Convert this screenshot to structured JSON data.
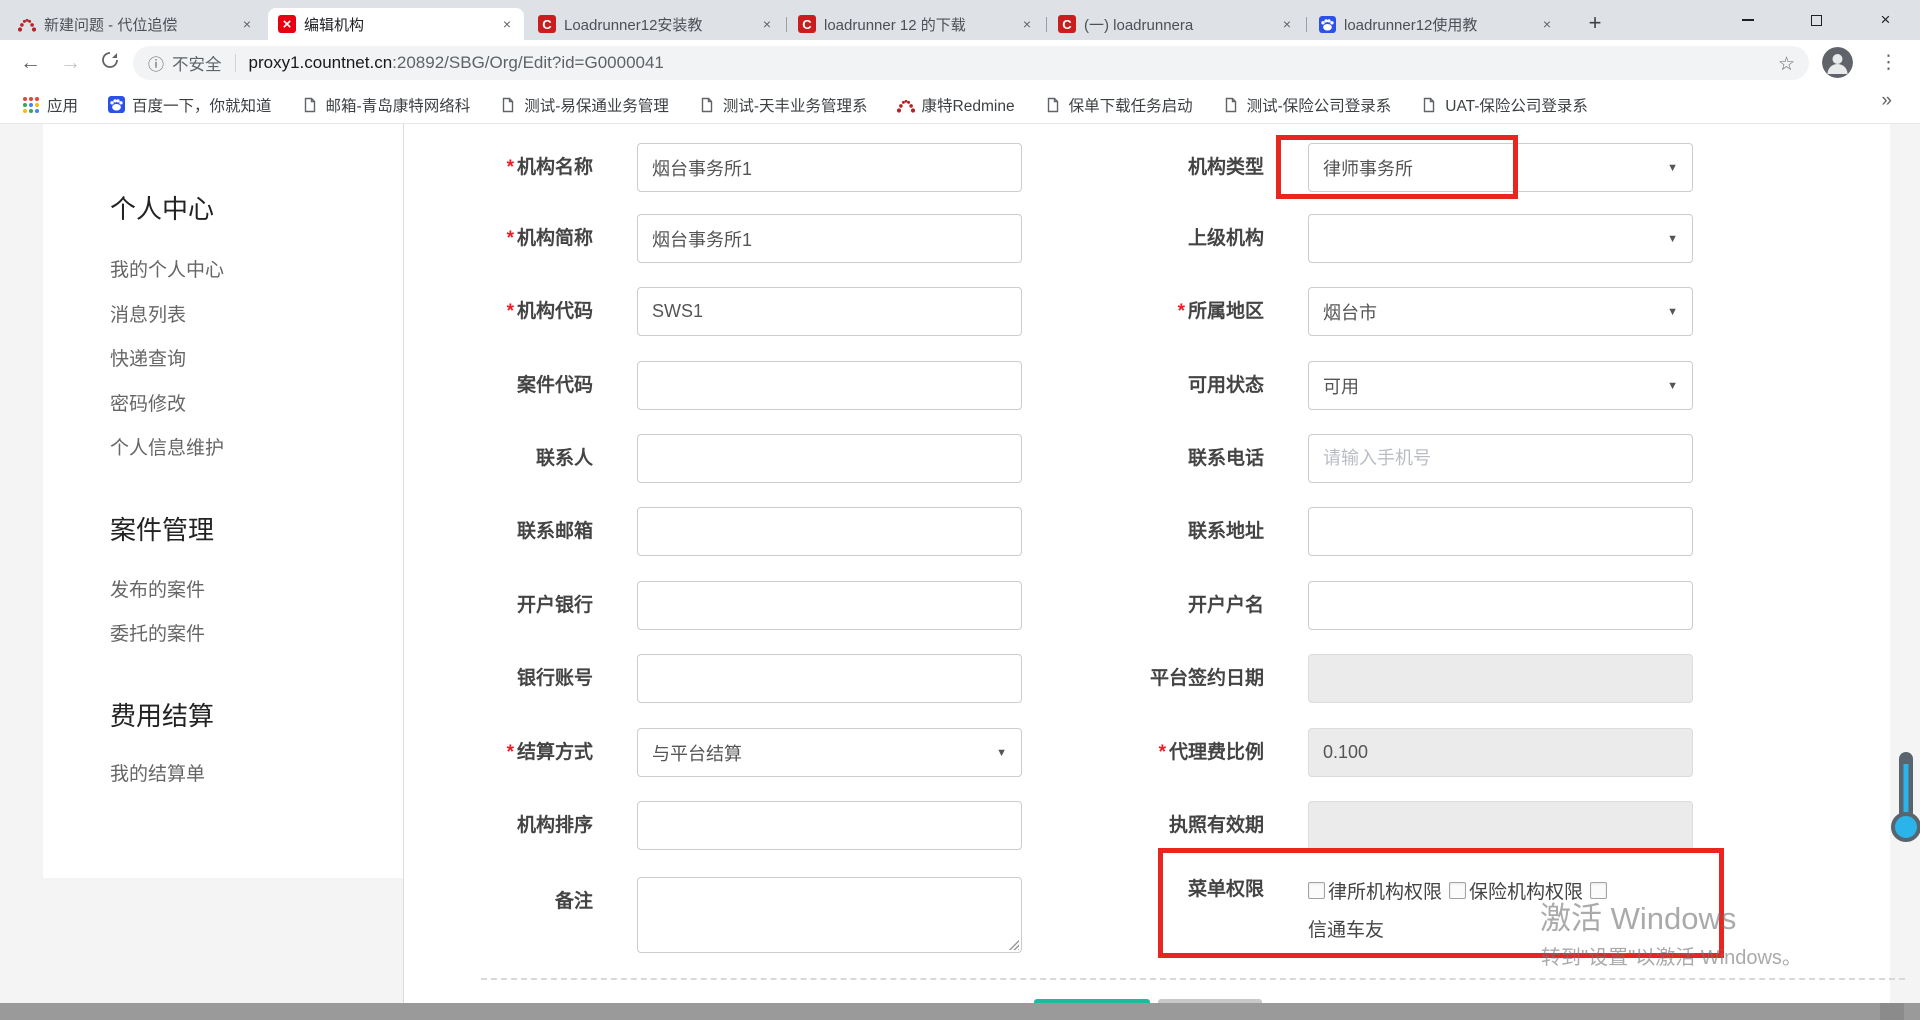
{
  "colors": {
    "chrome_bg": "#dee1e6",
    "highlight_red": "#e8251f",
    "save_teal": "#1abc9c",
    "scrollbar_grey": "#9a9a9a",
    "csdn_red": "#ca1e1e",
    "baidu_blue": "#2b51e8",
    "redmine_red": "#b3252a",
    "kangte_red": "#e60012"
  },
  "icons": {
    "close": "×",
    "plus": "+",
    "back": "←",
    "forward": "→",
    "info": "ⓘ",
    "star": "☆",
    "dots": "⋮",
    "overflow": "»",
    "dropdown": "▼"
  },
  "tabs": [
    {
      "title": "新建问题 - 代位追偿",
      "icon": "redmine",
      "active": false
    },
    {
      "title": "编辑机构",
      "icon": "kangte-x",
      "active": true
    },
    {
      "title": "Loadrunner12安装教",
      "icon": "csdn",
      "active": false
    },
    {
      "title": "loadrunner 12 的下载",
      "icon": "csdn",
      "active": false
    },
    {
      "title": "(一) loadrunnera",
      "icon": "csdn",
      "active": false
    },
    {
      "title": "loadrunner12使用教",
      "icon": "baidu",
      "active": false
    }
  ],
  "address": {
    "security_label": "不安全",
    "url_host": "proxy1.countnet.cn",
    "url_rest": ":20892/SBG/Org/Edit?id=G0000041"
  },
  "bookmarks": [
    {
      "label": "应用",
      "icon": "apps-grid"
    },
    {
      "label": "百度一下，你就知道",
      "icon": "baidu"
    },
    {
      "label": "邮箱-青岛康特网络科",
      "icon": "page"
    },
    {
      "label": "测试-易保通业务管理",
      "icon": "page"
    },
    {
      "label": "测试-天丰业务管理系",
      "icon": "page"
    },
    {
      "label": "康特Redmine",
      "icon": "redmine"
    },
    {
      "label": "保单下载任务启动",
      "icon": "page"
    },
    {
      "label": "测试-保险公司登录系",
      "icon": "page"
    },
    {
      "label": "UAT-保险公司登录系",
      "icon": "page"
    }
  ],
  "bookmarks_overflow": "»",
  "sidebar": {
    "sections": [
      {
        "title": "个人中心",
        "items": [
          "我的个人中心",
          "消息列表",
          "快递查询",
          "密码修改",
          "个人信息维护"
        ]
      },
      {
        "title": "案件管理",
        "items": [
          "发布的案件",
          "委托的案件"
        ]
      },
      {
        "title": "费用结算",
        "items": [
          "我的结算单"
        ]
      }
    ]
  },
  "form": {
    "rows": [
      {
        "left": {
          "label": "机构名称",
          "required": true,
          "kind": "text",
          "value": "烟台事务所1"
        },
        "right": {
          "label": "机构类型",
          "required": false,
          "kind": "select",
          "value": "律师事务所",
          "highlighted": true
        }
      },
      {
        "left": {
          "label": "机构简称",
          "required": true,
          "kind": "text",
          "value": "烟台事务所1"
        },
        "right": {
          "label": "上级机构",
          "required": false,
          "kind": "select",
          "value": ""
        }
      },
      {
        "left": {
          "label": "机构代码",
          "required": true,
          "kind": "text",
          "value": "SWS1"
        },
        "right": {
          "label": "所属地区",
          "required": true,
          "kind": "select",
          "value": "烟台市"
        }
      },
      {
        "left": {
          "label": "案件代码",
          "required": false,
          "kind": "text",
          "value": ""
        },
        "right": {
          "label": "可用状态",
          "required": false,
          "kind": "select",
          "value": "可用"
        }
      },
      {
        "left": {
          "label": "联系人",
          "required": false,
          "kind": "text",
          "value": ""
        },
        "right": {
          "label": "联系电话",
          "required": false,
          "kind": "text",
          "value": "",
          "placeholder": "请输入手机号"
        }
      },
      {
        "left": {
          "label": "联系邮箱",
          "required": false,
          "kind": "text",
          "value": ""
        },
        "right": {
          "label": "联系地址",
          "required": false,
          "kind": "text",
          "value": ""
        }
      },
      {
        "left": {
          "label": "开户银行",
          "required": false,
          "kind": "text",
          "value": ""
        },
        "right": {
          "label": "开户户名",
          "required": false,
          "kind": "text",
          "value": ""
        }
      },
      {
        "left": {
          "label": "银行账号",
          "required": false,
          "kind": "text",
          "value": ""
        },
        "right": {
          "label": "平台签约日期",
          "required": false,
          "kind": "disabled",
          "value": ""
        }
      },
      {
        "left": {
          "label": "结算方式",
          "required": true,
          "kind": "select",
          "value": "与平台结算"
        },
        "right": {
          "label": "代理费比例",
          "required": true,
          "kind": "disabled",
          "value": "0.100"
        }
      },
      {
        "left": {
          "label": "机构排序",
          "required": false,
          "kind": "text",
          "value": ""
        },
        "right": {
          "label": "执照有效期",
          "required": false,
          "kind": "disabled",
          "value": ""
        }
      },
      {
        "left": {
          "label": "备注",
          "required": false,
          "kind": "textarea",
          "value": ""
        },
        "right": {
          "label": "菜单权限",
          "required": false,
          "kind": "checkboxes",
          "options": [
            "律所机构权限",
            "保险机构权限",
            "信通车友"
          ],
          "highlighted": true
        }
      }
    ]
  },
  "watermark": {
    "line1": "激活 Windows",
    "line2": "转到\"设置\"以激活 Windows。"
  }
}
